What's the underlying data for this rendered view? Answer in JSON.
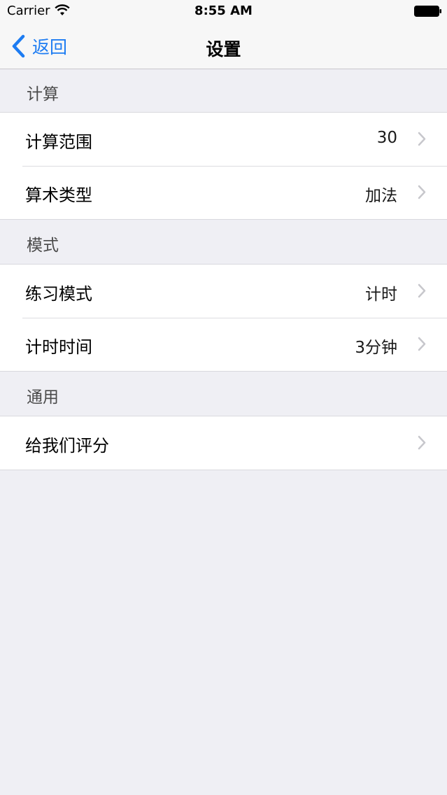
{
  "status_bar": {
    "carrier": "Carrier",
    "time": "8:55 AM",
    "icons": [
      "wifi-icon",
      "battery-icon"
    ]
  },
  "nav": {
    "back_label": "返回",
    "title": "设置",
    "back_icon": "chevron-left-icon"
  },
  "sections": [
    {
      "header": "计算",
      "rows": [
        {
          "label": "计算范围",
          "value": "30"
        },
        {
          "label": "算术类型",
          "value": "加法"
        }
      ]
    },
    {
      "header": "模式",
      "rows": [
        {
          "label": "练习模式",
          "value": "计时"
        },
        {
          "label": "计时时间",
          "value": "3分钟"
        }
      ]
    },
    {
      "header": "通用",
      "rows": [
        {
          "label": "给我们评分",
          "value": ""
        }
      ]
    }
  ],
  "colors": {
    "accent": "#1d7cf2",
    "background": "#efeff4",
    "cell": "#ffffff",
    "chevron": "#c7c7cc"
  }
}
